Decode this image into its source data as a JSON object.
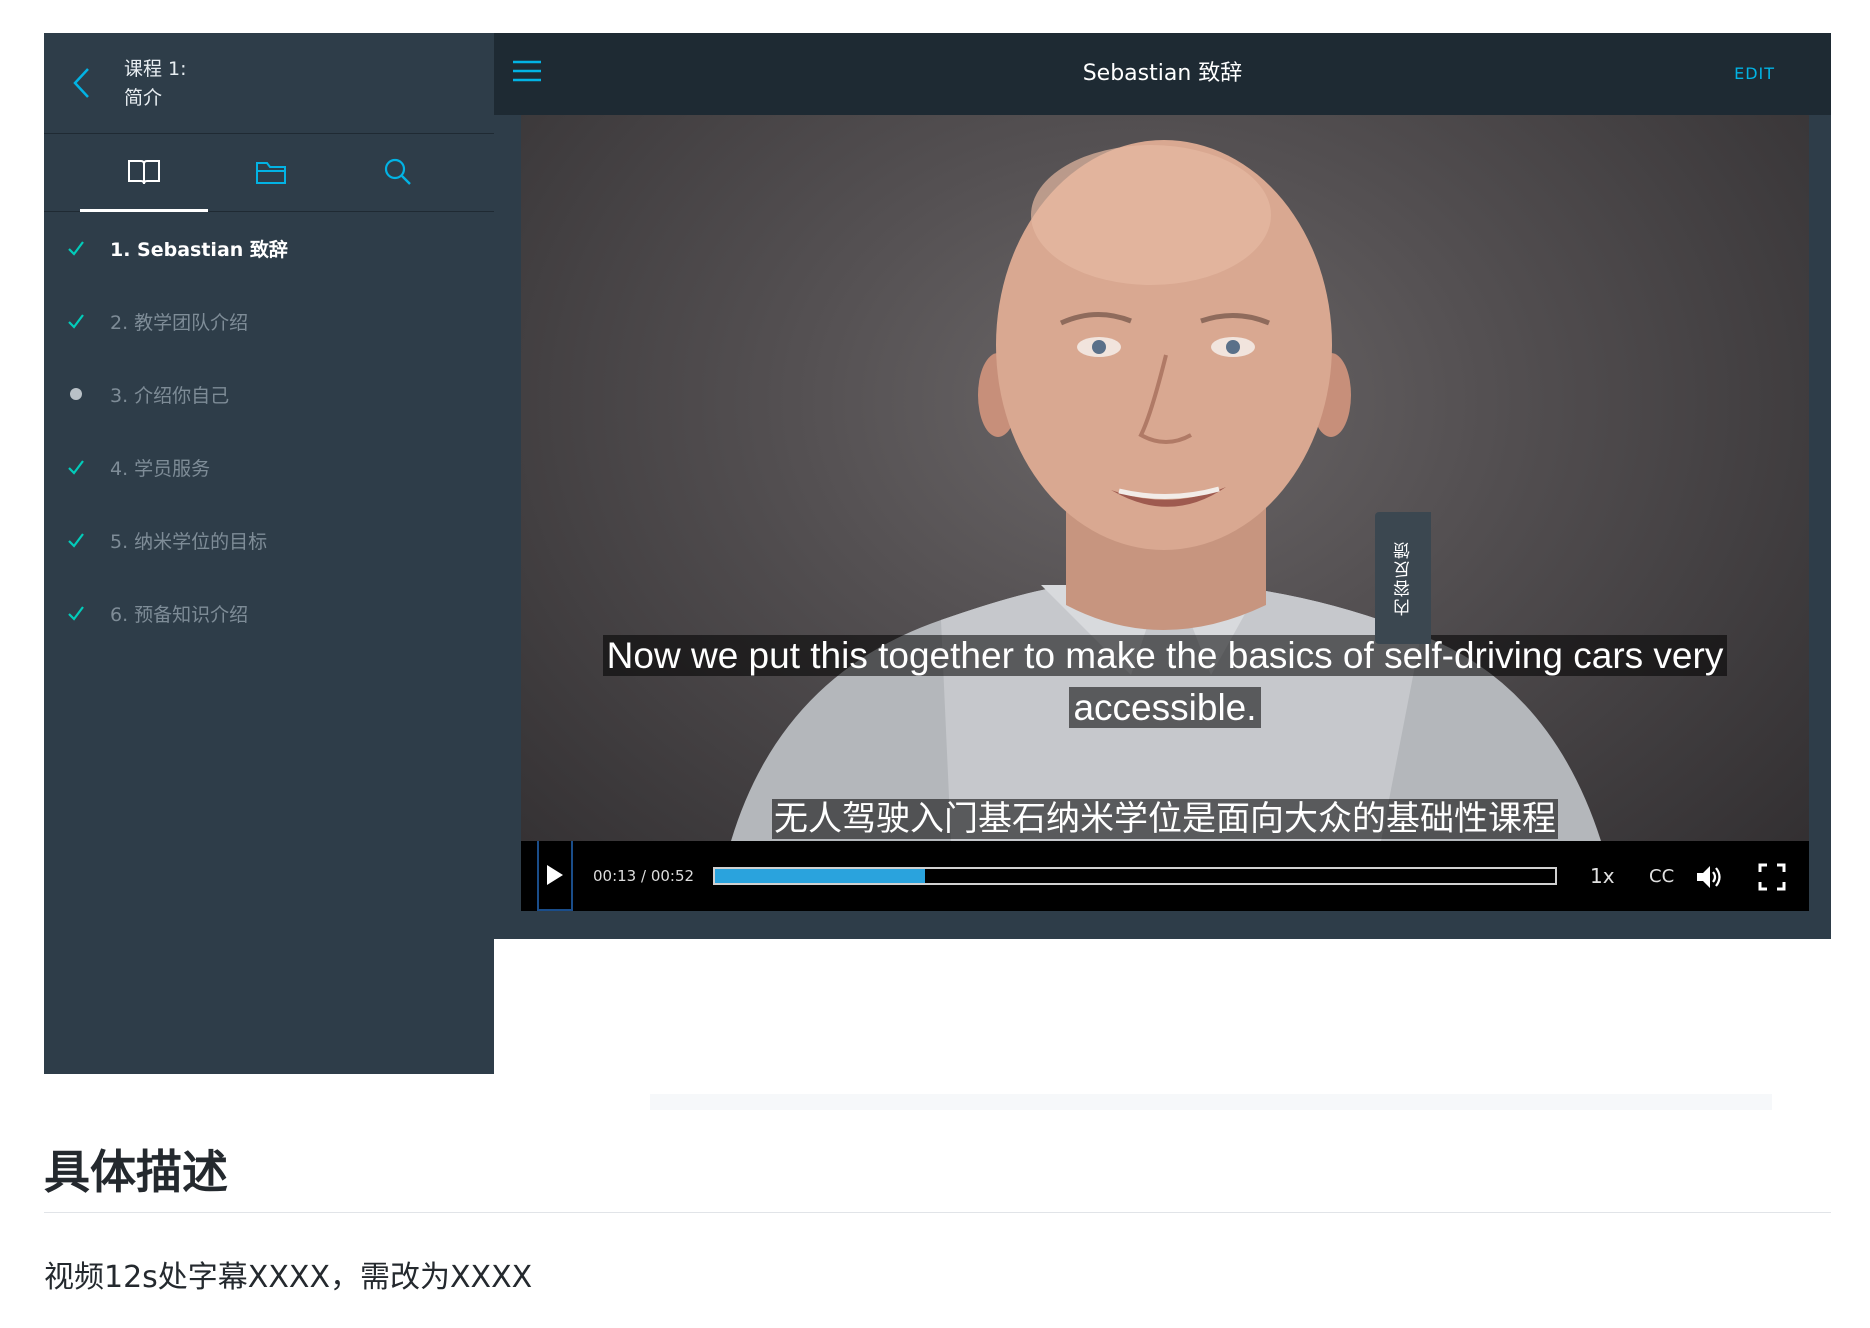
{
  "sidebar": {
    "course_label": "课程 1:",
    "course_name": "简介",
    "tabs": [
      {
        "icon": "book-icon",
        "active": true
      },
      {
        "icon": "folder-icon",
        "active": false
      },
      {
        "icon": "search-icon",
        "active": false
      }
    ],
    "lessons": [
      {
        "label": "1. Sebastian 致辞",
        "status": "completed",
        "current": true
      },
      {
        "label": "2. 教学团队介绍",
        "status": "completed",
        "current": false
      },
      {
        "label": "3. 介绍你自己",
        "status": "not-completed",
        "current": false
      },
      {
        "label": "4. 学员服务",
        "status": "completed",
        "current": false
      },
      {
        "label": "5. 纳米学位的目标",
        "status": "completed",
        "current": false
      },
      {
        "label": "6. 预备知识介绍",
        "status": "completed",
        "current": false
      }
    ]
  },
  "topbar": {
    "title": "Sebastian 致辞",
    "edit_label": "EDIT"
  },
  "video": {
    "subtitle_en_line1": "Now we put this together to make the basics of self-driving cars very",
    "subtitle_en_line2": "accessible.",
    "subtitle_zh": "无人驾驶入门基石纳米学位是面向大众的基础性课程",
    "time_display": "00:13 / 00:52",
    "progress_fraction": 0.25,
    "speed_label": "1x",
    "cc_label": "CC"
  },
  "feedback_tab": {
    "label": "内容反馈"
  },
  "description": {
    "heading": "具体描述",
    "body": "视频12s处字幕XXXX，需改为XXXX"
  },
  "colors": {
    "sidebar_bg": "#2e3d49",
    "topbar_bg": "#1e2a33",
    "accent": "#02b3e4",
    "check": "#02ccba",
    "progress": "#2aa3dd"
  }
}
